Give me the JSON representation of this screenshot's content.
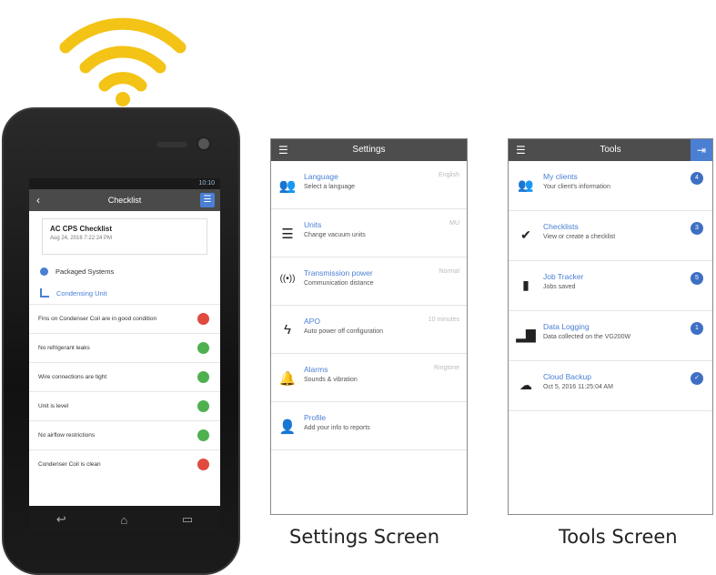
{
  "colors": {
    "wifi": "#f3c316",
    "accent": "#4a7fd4",
    "header": "#4d4d4d",
    "ok": "#4fb04f",
    "fail": "#e04a3f"
  },
  "phone": {
    "status_time": "10:10",
    "header_title": "Checklist",
    "card_title": "AC CPS Checklist",
    "card_date": "Aug 24, 2016 7:22:24 PM",
    "system_label": "Packaged Systems",
    "unit_label": "Condensing Unit",
    "items": [
      {
        "label": "Fins on Condenser Coil are in good condition",
        "status": "fail"
      },
      {
        "label": "No refrigerant leaks",
        "status": "ok"
      },
      {
        "label": "Wire connections are tight",
        "status": "ok"
      },
      {
        "label": "Unit is level",
        "status": "ok"
      },
      {
        "label": "No airflow restrictions",
        "status": "ok"
      },
      {
        "label": "Condenser Coil is clean",
        "status": "fail"
      }
    ]
  },
  "settings": {
    "title": "Settings",
    "items": [
      {
        "icon": "people-icon",
        "title": "Language",
        "subtitle": "Select a language",
        "value": "English"
      },
      {
        "icon": "sliders-icon",
        "title": "Units",
        "subtitle": "Change vacuum units",
        "value": "MU"
      },
      {
        "icon": "signal-icon",
        "title": "Transmission power",
        "subtitle": "Communication distance",
        "value": "Normal"
      },
      {
        "icon": "bolt-icon",
        "title": "APO",
        "subtitle": "Auto power off configuration",
        "value": "10 minutes"
      },
      {
        "icon": "bell-icon",
        "title": "Alarms",
        "subtitle": "Sounds & vibration",
        "value": "Ringtone"
      },
      {
        "icon": "person-icon",
        "title": "Profile",
        "subtitle": "Add your info to reports",
        "value": ""
      }
    ],
    "caption": "Settings Screen"
  },
  "tools": {
    "title": "Tools",
    "items": [
      {
        "icon": "clients-icon",
        "title": "My clients",
        "subtitle": "Your client's information",
        "badge": "4"
      },
      {
        "icon": "check-icon",
        "title": "Checklists",
        "subtitle": "View or create a checklist",
        "badge": "3"
      },
      {
        "icon": "document-icon",
        "title": "Job Tracker",
        "subtitle": "Jobs saved",
        "badge": "5"
      },
      {
        "icon": "bar-chart-icon",
        "title": "Data Logging",
        "subtitle": "Data collected on the VG200W",
        "badge": "1"
      },
      {
        "icon": "cloud-icon",
        "title": "Cloud Backup",
        "subtitle": "Oct 5, 2016 11:25:04 AM",
        "badge": "✓"
      }
    ],
    "caption": "Tools Screen"
  }
}
